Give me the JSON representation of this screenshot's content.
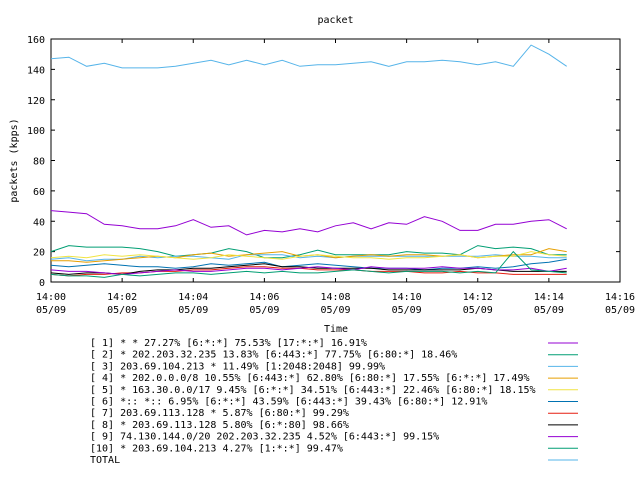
{
  "chart_data": {
    "type": "line",
    "title": "packet",
    "xlabel": "Time",
    "ylabel": "packets (kpps)",
    "ylim": [
      0,
      160
    ],
    "yticks": [
      "0",
      "20",
      "40",
      "60",
      "80",
      "100",
      "120",
      "140",
      "160"
    ],
    "xlim_minutes": [
      0,
      16
    ],
    "xticks": [
      {
        "time": "14:00",
        "date": "05/09"
      },
      {
        "time": "14:02",
        "date": "05/09"
      },
      {
        "time": "14:04",
        "date": "05/09"
      },
      {
        "time": "14:06",
        "date": "05/09"
      },
      {
        "time": "14:08",
        "date": "05/09"
      },
      {
        "time": "14:10",
        "date": "05/09"
      },
      {
        "time": "14:12",
        "date": "05/09"
      },
      {
        "time": "14:14",
        "date": "05/09"
      },
      {
        "time": "14:16",
        "date": "05/09"
      }
    ],
    "x_minutes": [
      0,
      0.5,
      1,
      1.5,
      2,
      2.5,
      3,
      3.5,
      4,
      4.5,
      5,
      5.5,
      6,
      6.5,
      7,
      7.5,
      8,
      8.5,
      9,
      9.5,
      10,
      10.5,
      11,
      11.5,
      12,
      12.5,
      13,
      13.5,
      14,
      14.5
    ],
    "series": [
      {
        "name": "[ 1] * * 27.27%  [6:*:*] 75.53% [17:*:*] 16.91%",
        "color": "#9400d3",
        "values": [
          47,
          46,
          45,
          38,
          37,
          35,
          35,
          37,
          41,
          36,
          37,
          31,
          34,
          33,
          35,
          33,
          37,
          39,
          35,
          39,
          38,
          43,
          40,
          34,
          34,
          38,
          38,
          40,
          41,
          35
        ]
      },
      {
        "name": "[ 2] * 202.203.32.235 13.83%  [6:443:*] 77.75% [6:80:*] 18.46%",
        "color": "#009e73",
        "values": [
          20,
          24,
          23,
          23,
          23,
          22,
          20,
          17,
          18,
          19,
          22,
          20,
          16,
          16,
          18,
          21,
          18,
          18,
          18,
          18,
          20,
          19,
          19,
          18,
          24,
          22,
          23,
          22,
          18,
          18
        ]
      },
      {
        "name": "[ 3] 203.69.104.213 * 11.49%  [1:2048:2048] 99.99%",
        "color": "#56b4e9",
        "values": [
          15,
          16,
          14,
          15,
          15,
          17,
          16,
          17,
          17,
          16,
          15,
          18,
          18,
          18,
          16,
          17,
          16,
          17,
          17,
          17,
          17,
          17,
          17,
          17,
          17,
          18,
          17,
          17,
          16,
          16
        ]
      },
      {
        "name": "[ 4] * 202.0.0.0/8 10.55%  [6:443:*] 62.80% [6:80:*] 17.55% [6:*:*] 17.49%",
        "color": "#e69f00",
        "values": [
          14,
          14,
          13,
          14,
          15,
          16,
          17,
          16,
          18,
          19,
          17,
          18,
          19,
          20,
          17,
          18,
          16,
          17,
          18,
          17,
          18,
          18,
          17,
          18,
          16,
          17,
          18,
          18,
          22,
          20
        ]
      },
      {
        "name": "[ 5] * 163.30.0.0/17 9.45%  [6:*:*] 34.51% [6:443:*] 22.46% [6:80:*] 18.15%",
        "color": "#f0e442",
        "values": [
          16,
          17,
          16,
          18,
          17,
          18,
          17,
          16,
          15,
          16,
          18,
          17,
          16,
          15,
          17,
          18,
          17,
          16,
          16,
          15,
          16,
          16,
          17,
          18,
          16,
          17,
          17,
          20,
          18,
          17
        ]
      },
      {
        "name": "[ 6] *:: *:: 6.95%  [6:*:*] 43.59% [6:443:*] 39.43% [6:80:*] 12.91%",
        "color": "#0072b2",
        "values": [
          11,
          10,
          11,
          12,
          11,
          10,
          10,
          9,
          10,
          12,
          11,
          12,
          13,
          10,
          11,
          12,
          11,
          10,
          9,
          9,
          9,
          8,
          9,
          9,
          10,
          9,
          10,
          12,
          13,
          15
        ]
      },
      {
        "name": "[ 7] 203.69.113.128 * 5.87%  [6:80:*] 99.29%",
        "color": "#e51e10",
        "values": [
          5,
          4,
          5,
          5,
          6,
          6,
          7,
          7,
          8,
          8,
          9,
          10,
          10,
          9,
          9,
          8,
          8,
          8,
          7,
          7,
          7,
          6,
          6,
          7,
          6,
          6,
          5,
          5,
          5,
          5
        ]
      },
      {
        "name": "[ 8] * 203.69.113.128 5.80%  [6:*:80] 98.66%",
        "color": "#000000",
        "values": [
          6,
          5,
          6,
          6,
          5,
          7,
          8,
          8,
          9,
          9,
          10,
          11,
          12,
          10,
          10,
          9,
          9,
          9,
          9,
          8,
          8,
          8,
          8,
          8,
          9,
          8,
          7,
          7,
          7,
          7
        ]
      },
      {
        "name": "[ 9] 74.130.144.0/20 202.203.32.235 4.52%  [6:443:*] 99.15%",
        "color": "#9400d3",
        "values": [
          8,
          7,
          7,
          6,
          5,
          6,
          7,
          8,
          7,
          7,
          8,
          9,
          9,
          8,
          9,
          10,
          9,
          8,
          10,
          9,
          9,
          9,
          10,
          9,
          9,
          8,
          8,
          9,
          7,
          9
        ]
      },
      {
        "name": "[10] * 203.69.104.213 4.27%  [1:*:*] 99.47%",
        "color": "#009e73",
        "values": [
          5,
          4,
          4,
          3,
          5,
          4,
          5,
          6,
          6,
          5,
          6,
          7,
          6,
          7,
          6,
          6,
          7,
          8,
          7,
          6,
          7,
          7,
          7,
          6,
          7,
          6,
          20,
          8,
          7,
          6
        ]
      },
      {
        "name": "TOTAL",
        "color": "#56b4e9",
        "values": [
          147,
          148,
          142,
          144,
          141,
          141,
          141,
          142,
          144,
          146,
          143,
          146,
          143,
          146,
          142,
          143,
          143,
          144,
          145,
          142,
          145,
          145,
          146,
          145,
          143,
          145,
          142,
          156,
          150,
          142
        ]
      }
    ]
  }
}
